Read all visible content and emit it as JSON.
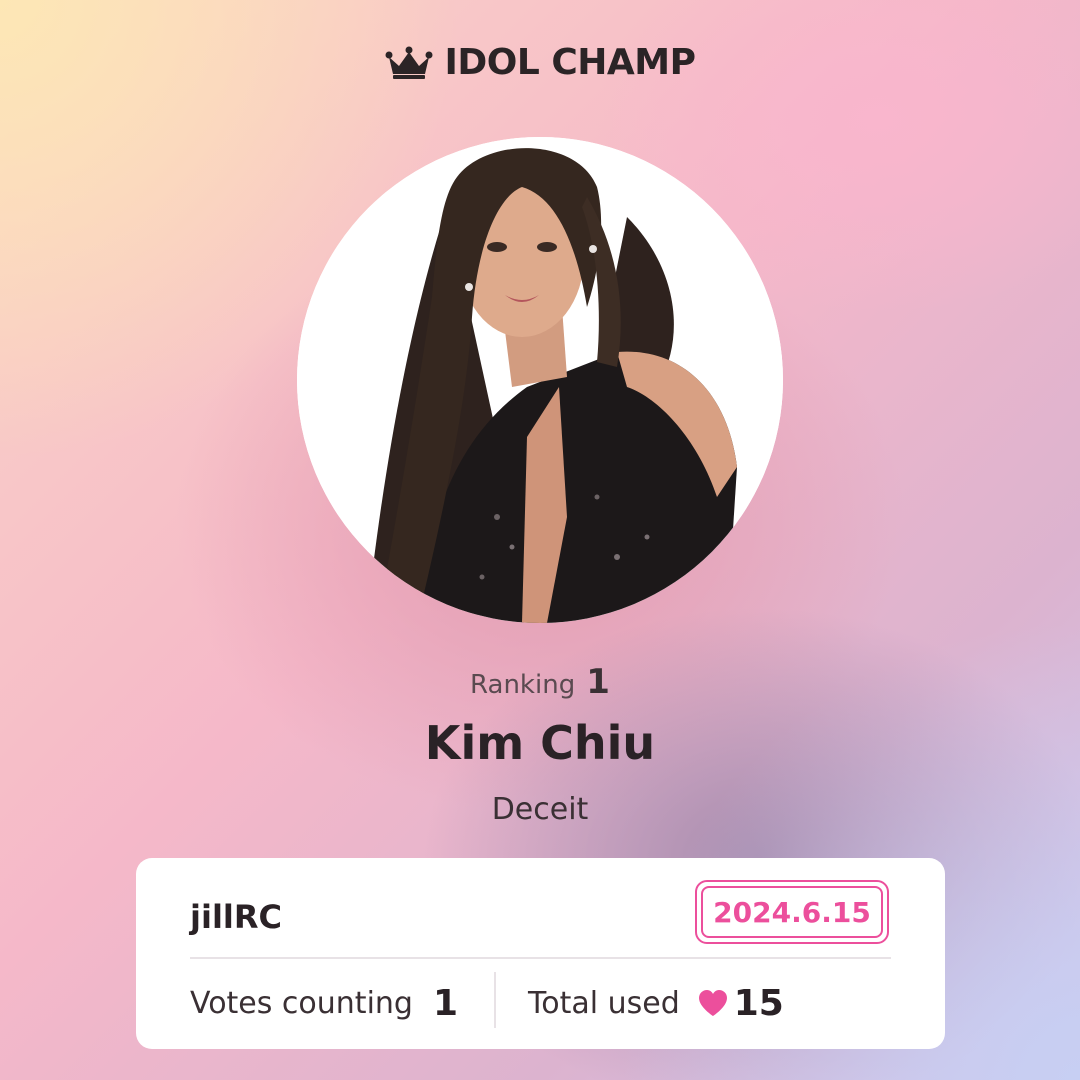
{
  "brand": {
    "name": "IDOL CHAMP",
    "icon": "crown-icon"
  },
  "profile": {
    "photo_alt": "idol-photo",
    "ranking_label": "Ranking",
    "ranking_value": "1",
    "name": "Kim Chiu",
    "subtitle": "Deceit"
  },
  "card": {
    "username": "jillRC",
    "date": "2024.6.15",
    "votes_label": "Votes counting",
    "votes_value": "1",
    "total_label": "Total used",
    "total_icon": "heart-icon",
    "total_value": "15"
  },
  "colors": {
    "accent": "#ec4f9c",
    "text": "#2a2226"
  }
}
